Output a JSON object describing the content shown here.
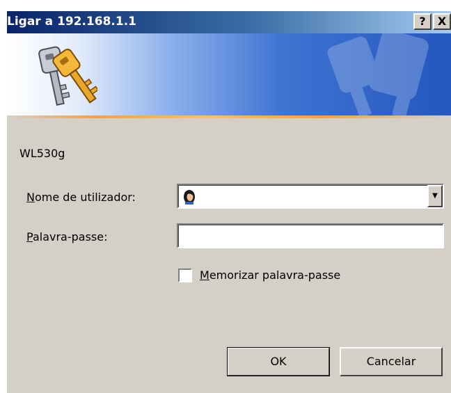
{
  "window": {
    "title": "Ligar a 192.168.1.1",
    "help_label": "?",
    "close_label": "X"
  },
  "form": {
    "site_name": "WL530g",
    "username_label_accel": "N",
    "username_label_rest": "ome de utilizador:",
    "username_value": "",
    "password_label_accel": "P",
    "password_label_rest": "alavra-passe:",
    "password_value": "",
    "remember_label_accel": "M",
    "remember_label_rest": "emorizar palavra-passe",
    "remember_checked": false
  },
  "buttons": {
    "ok_label": "OK",
    "cancel_label": "Cancelar"
  },
  "icons": {
    "banner": "keys-icon",
    "user": "user-icon",
    "dropdown": "chevron-down-icon"
  },
  "colors": {
    "title_start": "#0a246a",
    "title_end": "#a6caf0",
    "window_face": "#d4d0c8",
    "banner_blue": "#2457bf",
    "banner_glow": "#f3a04a"
  }
}
